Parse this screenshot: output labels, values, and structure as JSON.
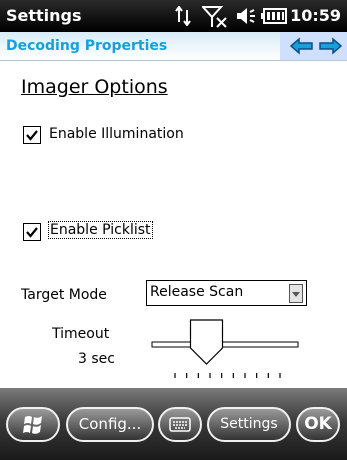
{
  "titlebar": {
    "app_title": "Settings",
    "time": "10:59",
    "icons": [
      "sync-icon",
      "signal-off-icon",
      "speaker-icon",
      "battery-icon"
    ]
  },
  "header": {
    "title": "Decoding Properties",
    "back_icon": "arrow-left-icon",
    "forward_icon": "arrow-right-icon",
    "accent_color": "#1aa0d8"
  },
  "content": {
    "section_title": "Imager Options",
    "enable_illumination": {
      "label": "Enable Illumination",
      "checked": true
    },
    "enable_picklist": {
      "label": "Enable Picklist",
      "checked": true
    },
    "target_mode": {
      "label": "Target Mode",
      "value": "Release Scan"
    },
    "timeout": {
      "label": "Timeout",
      "value": "3 sec",
      "slider_fraction": 0.3
    }
  },
  "softkeys": {
    "start_icon": "windows-logo-icon",
    "config": "Config...",
    "keyboard_icon": "keyboard-icon",
    "settings": "Settings",
    "ok": "OK"
  }
}
